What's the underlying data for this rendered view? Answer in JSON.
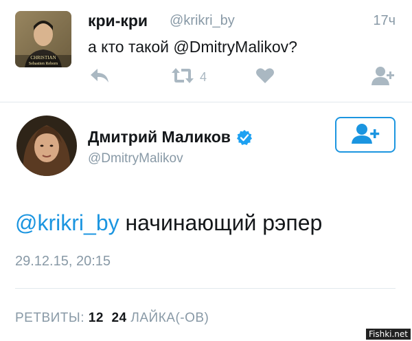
{
  "tweet": {
    "avatar_caption": [
      "CHRISTIAN",
      "Sebastien Reborn"
    ],
    "author_name": "кри-кри",
    "handle": "@krikri_by",
    "time": "17ч",
    "text": "а кто такой @DmitryMalikov?",
    "retweet_count": "4",
    "actions": [
      "reply-icon",
      "retweet-icon",
      "like-icon",
      "follow-icon"
    ]
  },
  "reply": {
    "author_name": "Дмитрий Маликов",
    "handle": "@DmitryMalikov",
    "verified": true,
    "follow_icon": "add-user-icon",
    "mention": "@krikri_by",
    "text": " начинающий рэпер",
    "timestamp": "29.12.15, 20:15",
    "retweets_label": "РЕТВИТЫ:",
    "retweets_count": "12",
    "likes_count": "24",
    "likes_label": "ЛАЙКА(-ОВ)"
  },
  "watermark": "Fishki.net",
  "colors": {
    "accent": "#1b95e0",
    "muted": "#8899a6",
    "icon": "#aab8c2"
  }
}
